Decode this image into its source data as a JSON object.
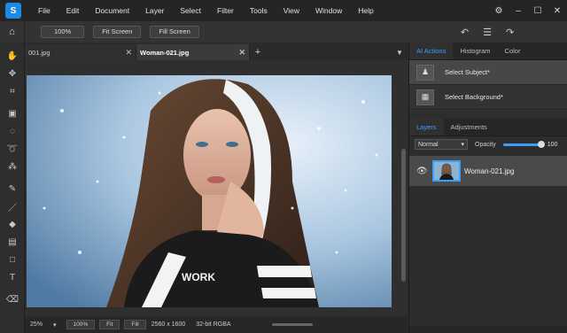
{
  "menu": {
    "items": [
      "File",
      "Edit",
      "Document",
      "Layer",
      "Select",
      "Filter",
      "Tools",
      "View",
      "Window",
      "Help"
    ]
  },
  "window_controls": {
    "minimize": "–",
    "maximize": "☐",
    "close": "✕",
    "settings": "⚙"
  },
  "toolbar": {
    "zoom_label": "100%",
    "fit_screen": "Fit Screen",
    "fill_screen": "Fill Screen"
  },
  "tabs": [
    {
      "label": "001.jpg",
      "active": false
    },
    {
      "label": "Woman-021.jpg",
      "active": true
    }
  ],
  "tab_close": "✕",
  "tab_add": "+",
  "tab_menu": "▼",
  "status": {
    "zoom": "25%",
    "zoom_btn": "100%",
    "fit_btn": "Fit",
    "fill_btn": "Fill",
    "dimensions": "2560 x 1600",
    "mode": "32-bit RGBA"
  },
  "right_panel": {
    "top_tabs": [
      "AI Actions",
      "Histogram",
      "Color"
    ],
    "ai_actions": [
      "Select Subject*",
      "Select Background*"
    ],
    "bottom_tabs": [
      "Layers",
      "Adjustments"
    ],
    "blend_mode": "Normal",
    "opacity_label": "Opacity",
    "opacity_value": "100",
    "layer_name": "Woman-021.jpg"
  },
  "colors": {
    "accent": "#3aa0ff",
    "bg": "#2b2b2b"
  }
}
